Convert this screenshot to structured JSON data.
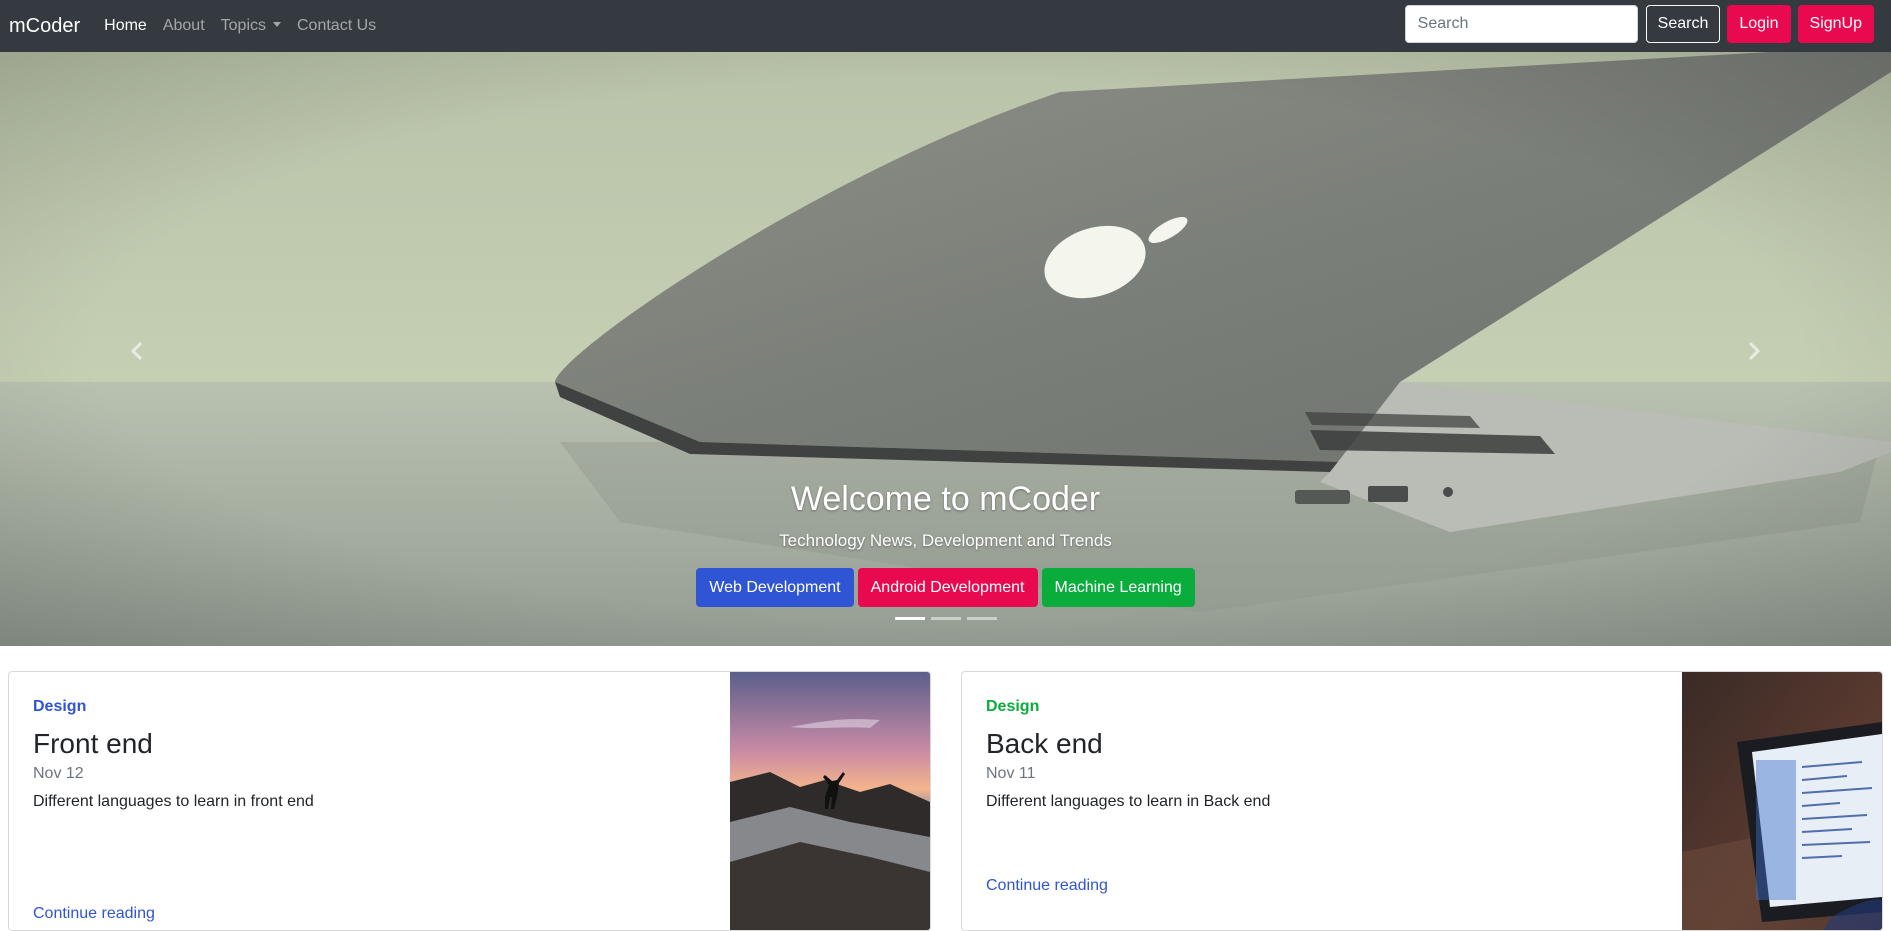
{
  "navbar": {
    "brand": "mCoder",
    "links": [
      {
        "label": "Home"
      },
      {
        "label": "About"
      },
      {
        "label": "Topics"
      },
      {
        "label": "Contact Us"
      }
    ],
    "search_placeholder": "Search",
    "search_button": "Search",
    "login_button": "Login",
    "signup_button": "SignUp"
  },
  "hero": {
    "title": "Welcome to mCoder",
    "subtitle": "Technology News, Development and Trends",
    "buttons": [
      {
        "label": "Web Development",
        "color": "#2f55d4"
      },
      {
        "label": "Android Development",
        "color": "#e8094f"
      },
      {
        "label": "Machine Learning",
        "color": "#0aad3c"
      }
    ],
    "slide_count": 3,
    "active_slide": 1
  },
  "cards": [
    {
      "category": "Design",
      "category_color": "#2f55d4",
      "title": "Front end",
      "date": "Nov 12",
      "text": "Different languages to learn in front end",
      "link": "Continue reading"
    },
    {
      "category": "Design",
      "category_color": "#0aad3c",
      "title": "Back end",
      "date": "Nov 11",
      "text": "Different languages to learn in Back end",
      "link": "Continue reading"
    }
  ],
  "colors": {
    "navbar_bg": "#343a40",
    "accent_red": "#e8094f",
    "link_blue": "#2f55d4"
  }
}
